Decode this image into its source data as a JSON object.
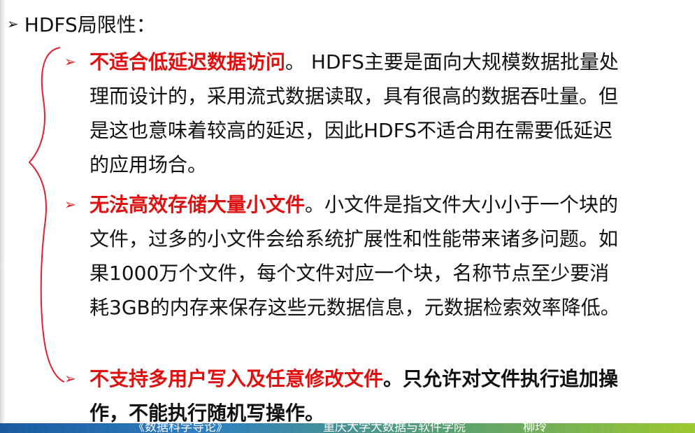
{
  "heading": {
    "arrow": "➢",
    "text": "HDFS局限性："
  },
  "bullets": {
    "b1": {
      "marker": "➢",
      "title": "不适合低延迟数据访问",
      "body": "。 HDFS主要是面向大规模数据批量处理而设计的，采用流式数据读取，具有很高的数据吞吐量。但是这也意味着较高的延迟，因此HDFS不适合用在需要低延迟的应用场合。"
    },
    "b2": {
      "marker": "➢",
      "title": "无法高效存储大量小文件",
      "body": "。小文件是指文件大小小于一个块的文件，过多的小文件会给系统扩展性和性能带来诸多问题。如果1000万个文件，每个文件对应一个块，名称节点至少要消耗3GB的内存来保存这些元数据信息，元数据检索效率降低。"
    },
    "b3": {
      "marker": "➢",
      "title": "不支持多用户写入及任意修改文件",
      "body": "。只允许对文件执行追加操作，不能执行随机写操作。"
    }
  },
  "footer": {
    "course": "《数据科学导论》",
    "school": "重庆大学大数据与软件学院",
    "author": "柳玲"
  },
  "colors": {
    "accent_red": "#e01010",
    "text": "#111111"
  }
}
